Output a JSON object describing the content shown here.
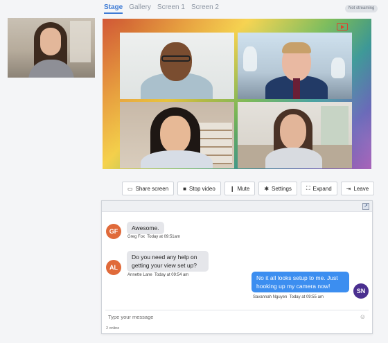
{
  "tabs": [
    {
      "label": "Stage",
      "active": true
    },
    {
      "label": "Gallery",
      "active": false
    },
    {
      "label": "Screen 1",
      "active": false
    },
    {
      "label": "Screen 2",
      "active": false
    }
  ],
  "status_badge": "Not streaming",
  "controls": [
    {
      "label": "Share screen",
      "icon": "monitor-icon",
      "glyph": "▭"
    },
    {
      "label": "Stop video",
      "icon": "video-camera-icon",
      "glyph": "■"
    },
    {
      "label": "Mute",
      "icon": "microphone-icon",
      "glyph": "❙"
    },
    {
      "label": "Settings",
      "icon": "gear-icon",
      "glyph": "✱"
    },
    {
      "label": "Expand",
      "icon": "expand-icon",
      "glyph": "⛶"
    },
    {
      "label": "Leave",
      "icon": "exit-icon",
      "glyph": "⇥"
    }
  ],
  "chat": {
    "messages": [
      {
        "initials": "GF",
        "text": "Awesome.",
        "author": "Greg Fox",
        "time": "Today at 09:51am",
        "avatar_color": "#e06a3a"
      },
      {
        "initials": "AL",
        "text": "Do you need any help on getting your view set up?",
        "author": "Annette Lane",
        "time": "Today at 09:54 am",
        "avatar_color": "#e06a3a"
      },
      {
        "initials": "SN",
        "text": "No it all looks setup to me. Just hooking up my camera now!",
        "author": "Savannah Nguyen",
        "time": "Today at 09:55 am",
        "avatar_color": "#4a2f8f"
      }
    ],
    "input_placeholder": "Type your message",
    "online_count": "2 online"
  },
  "colors": {
    "accent": "#3e7bd5",
    "outgoing_bubble": "#3c8ef0",
    "record_icon": "#e0412b"
  }
}
